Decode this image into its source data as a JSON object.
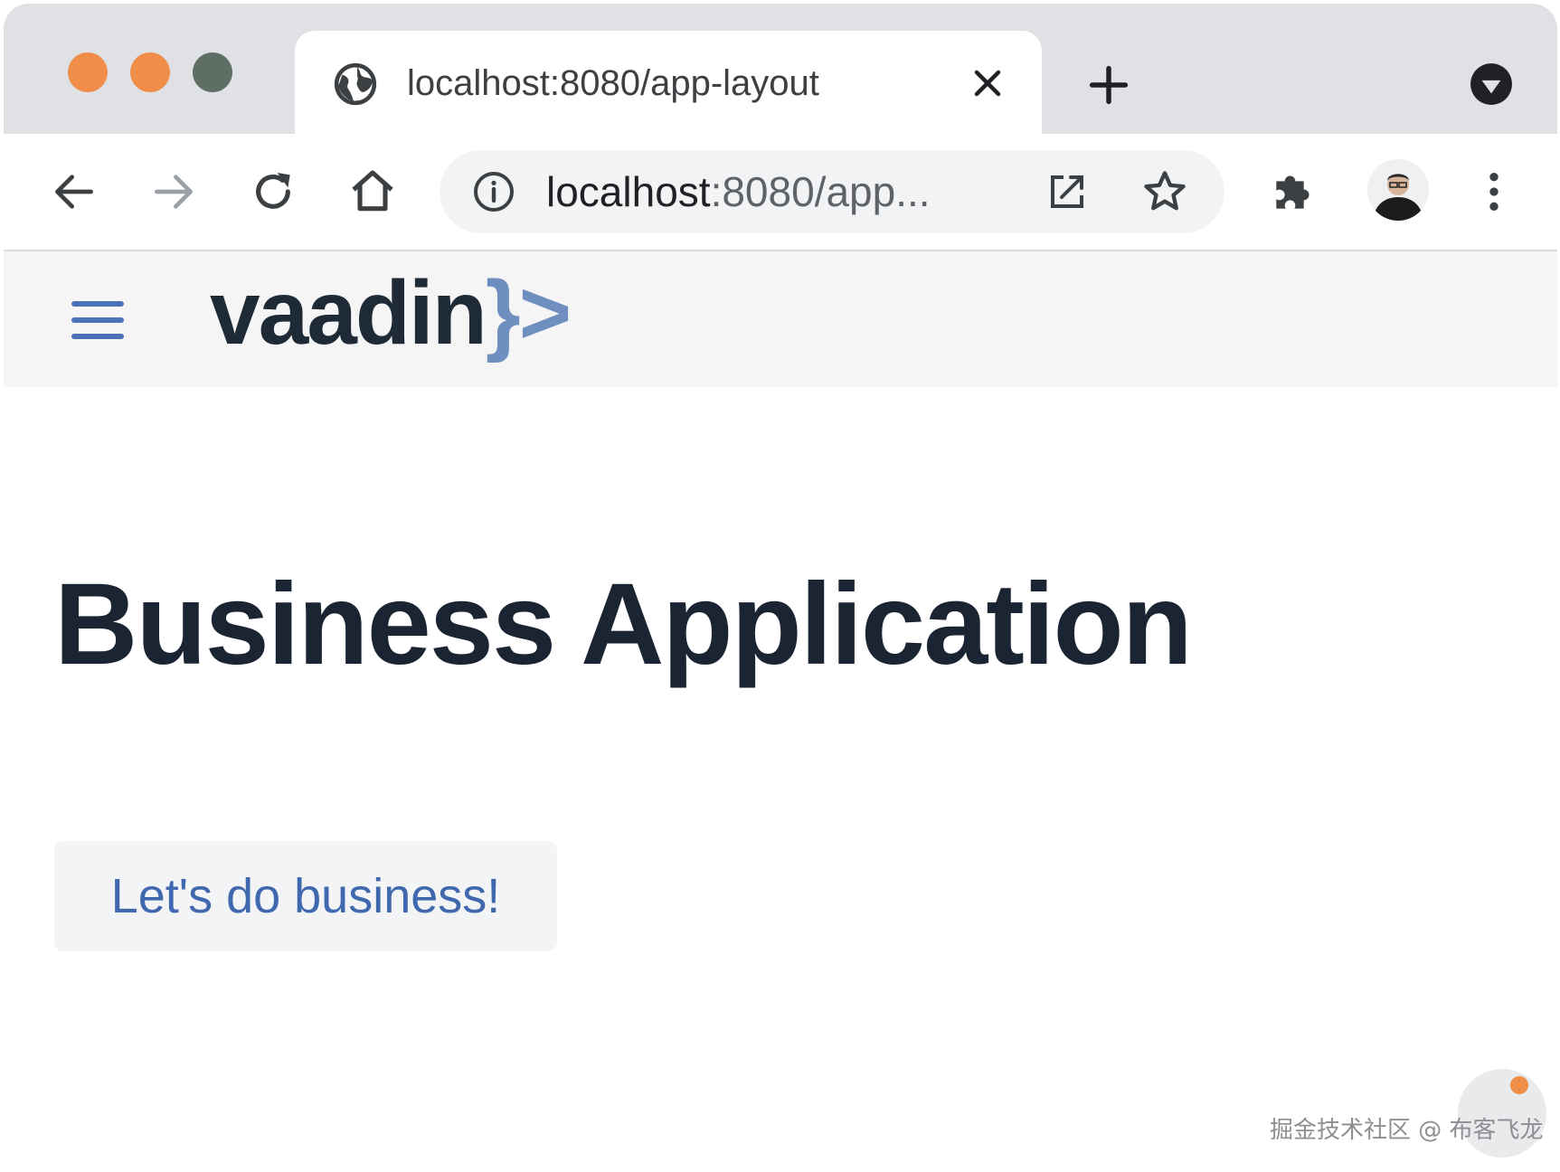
{
  "browser": {
    "tab": {
      "title": "localhost:8080/app-layout"
    },
    "omnibox": {
      "url_host": "localhost",
      "url_rest": ":8080/app..."
    }
  },
  "app": {
    "logo_text": "vaadin",
    "logo_brace": "}",
    "logo_gt": ">",
    "page_title": "Business Application",
    "cta_label": "Let's do business!"
  },
  "watermark": {
    "text": "掘金技术社区 @ 布客飞龙"
  },
  "colors": {
    "traffic_orange": "#f08d48",
    "traffic_gray": "#5e6e65",
    "accent_blue": "#3f68ae",
    "title_dark": "#1b2433"
  },
  "icons": {
    "tab": [
      "globe-icon",
      "close-icon",
      "plus-icon",
      "tab-search-icon"
    ],
    "toolbar": [
      "back-arrow-icon",
      "forward-arrow-icon",
      "reload-icon",
      "home-icon",
      "info-icon",
      "open-in-new-icon",
      "star-icon",
      "puzzle-icon",
      "avatar",
      "more-vert-icon"
    ],
    "app": [
      "hamburger-menu-icon"
    ]
  }
}
